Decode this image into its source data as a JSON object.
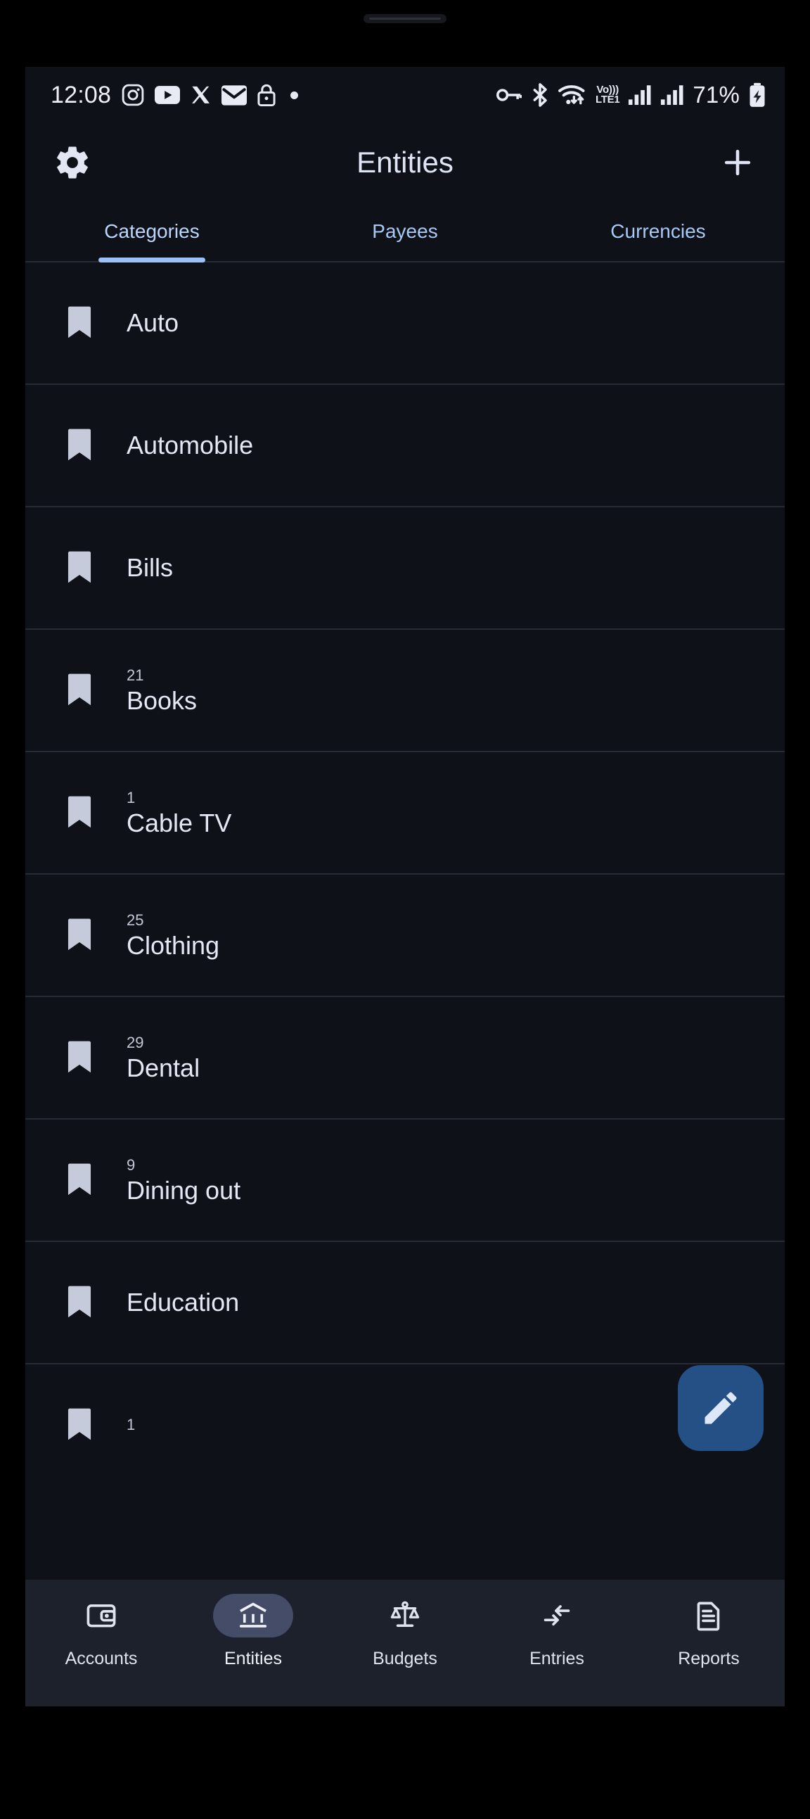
{
  "status_bar": {
    "time": "12:08",
    "left_icons": [
      "instagram-icon",
      "youtube-icon",
      "x-twitter-icon",
      "gmail-icon",
      "lock-icon",
      "dot-indicator-icon"
    ],
    "right_icons": [
      "vpn-key-icon",
      "bluetooth-icon",
      "wifi-icon",
      "volte-icon",
      "signal-icon-1",
      "signal-icon-2"
    ],
    "volte_top": "Vo)))",
    "volte_bottom": "LTE1",
    "battery_percent": "71%",
    "battery_state": "charging"
  },
  "app_bar": {
    "title": "Entities",
    "settings_icon": "gear-icon",
    "add_icon": "plus-icon"
  },
  "tabs": {
    "active_index": 0,
    "items": [
      {
        "label": "Categories"
      },
      {
        "label": "Payees"
      },
      {
        "label": "Currencies"
      }
    ]
  },
  "list": {
    "item_icon": "bookmark-icon",
    "items": [
      {
        "label": "Auto",
        "count": ""
      },
      {
        "label": "Automobile",
        "count": ""
      },
      {
        "label": "Bills",
        "count": ""
      },
      {
        "label": "Books",
        "count": "21"
      },
      {
        "label": "Cable TV",
        "count": "1"
      },
      {
        "label": "Clothing",
        "count": "25"
      },
      {
        "label": "Dental",
        "count": "29"
      },
      {
        "label": "Dining out",
        "count": "9"
      },
      {
        "label": "Education",
        "count": ""
      },
      {
        "label": "",
        "count": "1"
      }
    ]
  },
  "fab": {
    "icon": "pencil-edit-icon",
    "color": "#245086"
  },
  "bottom_nav": {
    "active_index": 1,
    "items": [
      {
        "label": "Accounts",
        "icon": "wallet-icon"
      },
      {
        "label": "Entities",
        "icon": "bank-building-icon"
      },
      {
        "label": "Budgets",
        "icon": "balance-scale-icon"
      },
      {
        "label": "Entries",
        "icon": "transfer-arrows-icon"
      },
      {
        "label": "Reports",
        "icon": "document-icon"
      }
    ]
  },
  "theme": {
    "background": "#0e1118",
    "nav_background": "#1c212c",
    "accent": "#9dc0f7",
    "tab_text": "#a8c8f5",
    "active_pill": "#454c68"
  }
}
